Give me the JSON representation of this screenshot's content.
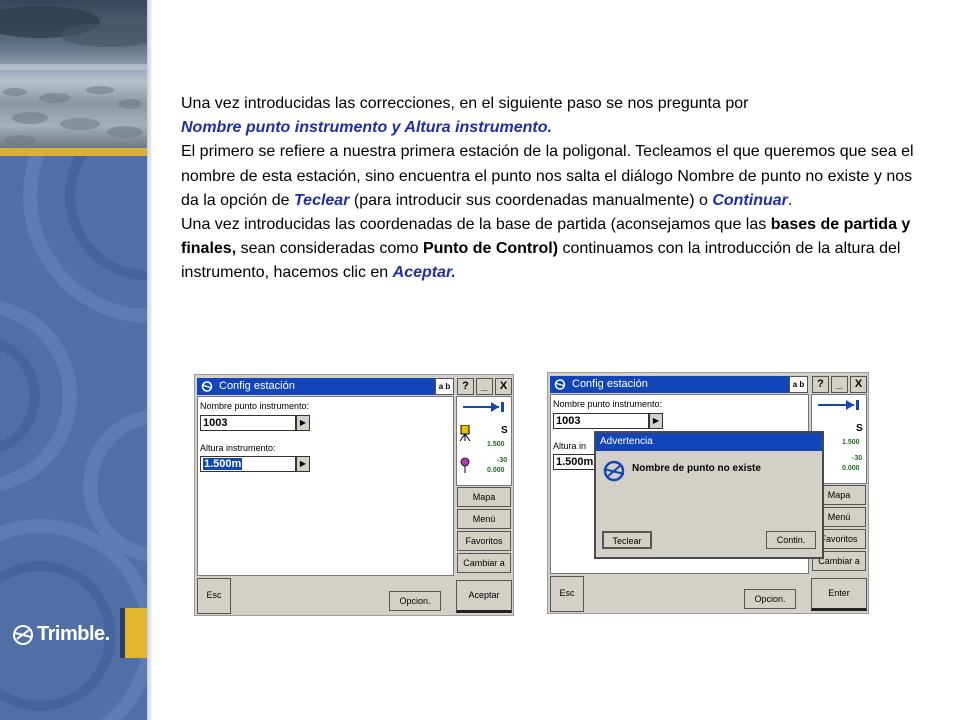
{
  "brand": {
    "logo_text": "Trimble.",
    "colors": {
      "band": "#4f6fa6",
      "gold": "#d9b13a",
      "title_blue": "#1246b8",
      "emphasis_blue": "#1d2fa6"
    }
  },
  "text": {
    "p1": "Una vez introducidas las correcciones, en el siguiente paso se nos pregunta por",
    "p1_em": "Nombre punto instrumento y Altura instrumento.",
    "p2_a": "El primero se refiere a nuestra primera estación de la poligonal. Tecleamos el que queremos que sea el nombre de esta estación, sino encuentra el punto nos salta el diálogo Nombre de punto no existe y nos da la opción de",
    "p2_teclear": "Teclear",
    "p2_b": "(para introducir sus coordenadas manualmente) o",
    "p2_continuar": "Continuar",
    "p2_end": ".",
    "p3_a": "Una vez introducidas las coordenadas de la base de partida (aconsejamos que las",
    "p3_bold1": "bases de partida y finales,",
    "p3_b": "sean consideradas como",
    "p3_bold2": "Punto de Control)",
    "p3_c": "continuamos con la introducción de la altura del instrumento, hacemos clic en",
    "p3_aceptar": "Aceptar."
  },
  "screen1": {
    "title": "Config estación",
    "ab": "a b",
    "ctl_help": "?",
    "ctl_min": "_",
    "ctl_close": "X",
    "name_label": "Nombre punto instrumento:",
    "name_value": "1003",
    "height_label": "Altura instrumento:",
    "height_value": "1.500m",
    "gps_s": "S",
    "gps_v1": "1.500",
    "gps_v2": "-30",
    "gps_v3": "0.000",
    "side": [
      "Mapa",
      "Menú",
      "Favoritos",
      "Cambiar a"
    ],
    "esc": "Esc",
    "options": "Opcion.",
    "accept": "Aceptar"
  },
  "screen2": {
    "title": "Config estación",
    "ab": "a b",
    "ctl_help": "?",
    "ctl_min": "_",
    "ctl_close": "X",
    "name_label": "Nombre punto instrumento:",
    "name_value": "1003",
    "height_label": "Altura in",
    "height_value": "1.500m",
    "gps_s": "S",
    "gps_v1": "1.500",
    "gps_v2": "-30",
    "gps_v3": "0.000",
    "side": [
      "Mapa",
      "Menú",
      "Favoritos",
      "Cambiar a"
    ],
    "esc": "Esc",
    "options": "Opcion.",
    "enter": "Enter",
    "dialog": {
      "title": "Advertencia",
      "message": "Nombre de punto no existe",
      "btn_key": "Teclear",
      "btn_continue": "Contin."
    }
  }
}
